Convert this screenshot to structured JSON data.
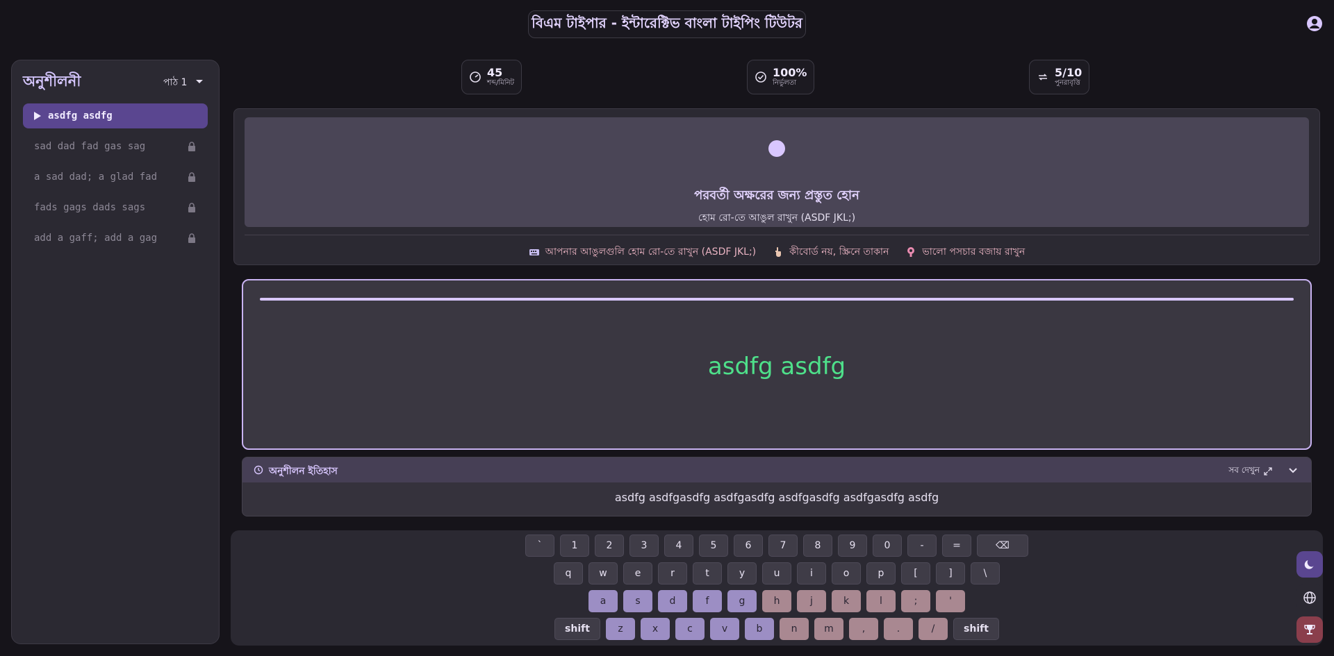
{
  "header": {
    "title": "বিএম টাইপার - ইন্টারেক্টিভ বাংলা টাইপিং টিউটর"
  },
  "sidebar": {
    "title": "অনুশীলনী",
    "lesson_selector": "পাঠ 1",
    "items": [
      {
        "label": "asdfg asdfg",
        "state": "active"
      },
      {
        "label": "sad dad fad gas sag",
        "state": "locked"
      },
      {
        "label": "a sad dad; a glad fad",
        "state": "locked"
      },
      {
        "label": "fads gags dads sags",
        "state": "locked"
      },
      {
        "label": "add a gaff; add a gag",
        "state": "locked"
      }
    ]
  },
  "stats": [
    {
      "icon": "speedometer-icon",
      "value": "45",
      "label": "শব্দ/মিনিট"
    },
    {
      "icon": "check-circle-icon",
      "value": "100%",
      "label": "নির্ভুলতা"
    },
    {
      "icon": "repeat-icon",
      "value": "5/10",
      "label": "পুনরাবৃত্তি"
    }
  ],
  "prompt": {
    "title": "পরবর্তী অক্ষরের জন্য প্রস্তুত হোন",
    "subtitle": "হোম রো-তে আঙুল রাখুন (ASDF JKL;)",
    "tips": [
      {
        "icon": "keyboard-icon",
        "text": "আপনার আঙুলগুলি হোম রো-তে রাখুন (ASDF JKL;)"
      },
      {
        "icon": "hand-pointer-icon",
        "text": "কীবোর্ড নয়, স্ক্রিনে তাকান"
      },
      {
        "icon": "posture-icon",
        "text": "ভালো পসচার বজায় রাখুন"
      }
    ]
  },
  "typing": {
    "text": "asdfg asdfg",
    "progress": 1.0
  },
  "history": {
    "title": "অনুশীলন ইতিহাস",
    "see_all": "সব দেখুন",
    "text": "asdfg asdfgasdfg asdfgasdfg asdfgasdfg asdfgasdfg asdfg"
  },
  "keyboard": {
    "row1": [
      "`",
      "1",
      "2",
      "3",
      "4",
      "5",
      "6",
      "7",
      "8",
      "9",
      "0",
      "-",
      "=",
      "⌫"
    ],
    "row2": [
      "q",
      "w",
      "e",
      "r",
      "t",
      "y",
      "u",
      "i",
      "o",
      "p",
      "[",
      "]",
      "\\"
    ],
    "row3": [
      "a",
      "s",
      "d",
      "f",
      "g",
      "h",
      "j",
      "k",
      "l",
      ";",
      "'"
    ],
    "row4": [
      "shift",
      "z",
      "x",
      "c",
      "v",
      "b",
      "n",
      "m",
      ",",
      ".",
      "/",
      "shift"
    ]
  },
  "colors": {
    "accent": "#d9c7ff",
    "typed_correct": "#4ee08a",
    "left_hand_key": "#9c8ec4",
    "right_hand_key": "#a98891"
  }
}
